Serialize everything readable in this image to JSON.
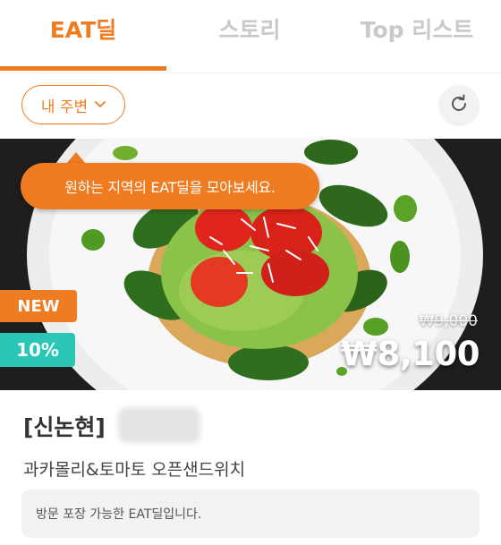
{
  "tabs": [
    {
      "label": "EAT딜",
      "active": true
    },
    {
      "label": "스토리",
      "active": false
    },
    {
      "label": "Top 리스트",
      "active": false
    }
  ],
  "filter": {
    "nearby_label": "내 주변",
    "nearby_icon": "chevron-down-icon",
    "refresh_icon": "refresh-icon"
  },
  "deal": {
    "tooltip": "원하는 지역의 EAT딜을 모아보세요.",
    "badge_new": "NEW",
    "discount": "10%",
    "original_price": "₩9,000",
    "price": "₩8,100",
    "store_name": "[신논현]",
    "menu_name": "과카몰리&토마토 오픈샌드위치",
    "note": "방문 포장 가능한 EAT딜입니다."
  },
  "colors": {
    "accent": "#f07c22",
    "discount_badge": "#2ac7b7",
    "inactive_tab": "#c9c9c9"
  }
}
